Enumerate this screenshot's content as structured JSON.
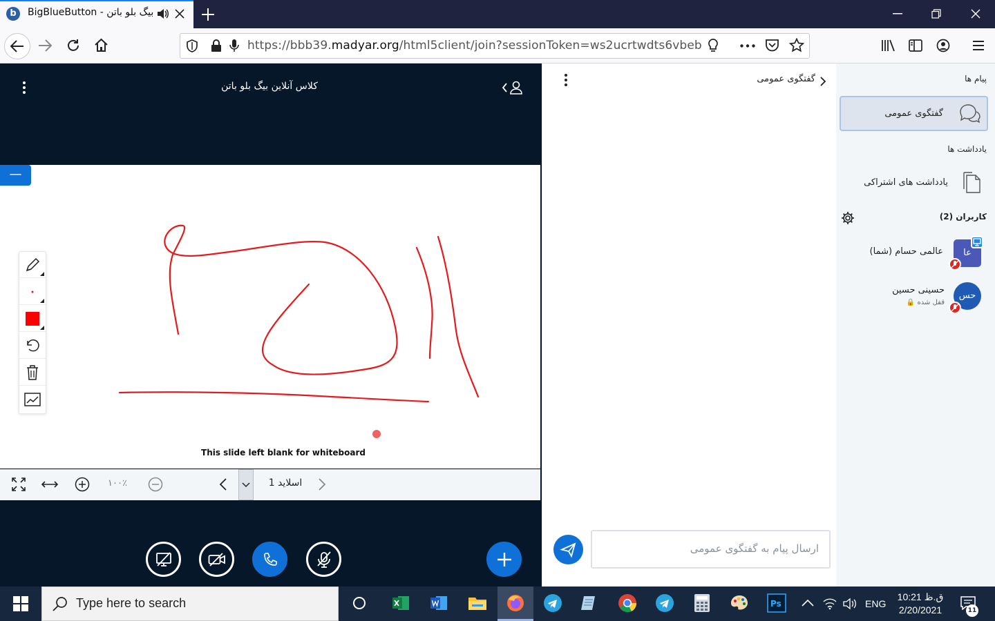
{
  "browser": {
    "tab_title": "BigBlueButton - ‫بیگ بلو باتن",
    "favicon_letter": "b",
    "url_prefix": "https://bbb39.",
    "url_domain": "madyar.org",
    "url_path": "/html5client/join?sessionToken=ws2ucrtwdts6vbeb"
  },
  "presentation": {
    "meeting_title": "کلاس آنلاین بیگ بلو باتن",
    "minimize_label": "—",
    "slide_caption": "This slide left blank for whiteboard",
    "zoom_label": "۱۰۰٪",
    "slide_label": "اسلاید 1"
  },
  "chat": {
    "header": "گفتگوی عمومی",
    "placeholder": "ارسال پیام به گفتگوی عمومی"
  },
  "userlist": {
    "messages_title": "پیام ها",
    "public_chat_label": "گفتگوی عمومی",
    "notes_title": "یادداشت ها",
    "shared_notes_label": "یادداشت های اشتراکی",
    "users_title": "کاربران (2)",
    "users": [
      {
        "name": "عالمی حسام (شما)",
        "initials": "عا",
        "status": "",
        "color": "#4a58b8"
      },
      {
        "name": "حسینی حسین",
        "initials": "حس",
        "status": "قفل شده",
        "color": "#1f5ab5"
      }
    ]
  },
  "taskbar": {
    "search_text": "Type here to search",
    "lang": "ENG",
    "time": "10:21 ق.ظ",
    "date": "2/20/2021",
    "notification_count": "11"
  },
  "colors": {
    "accent": "#0f70d7",
    "dark_bg": "#06172a",
    "pen": "#e8191b"
  }
}
